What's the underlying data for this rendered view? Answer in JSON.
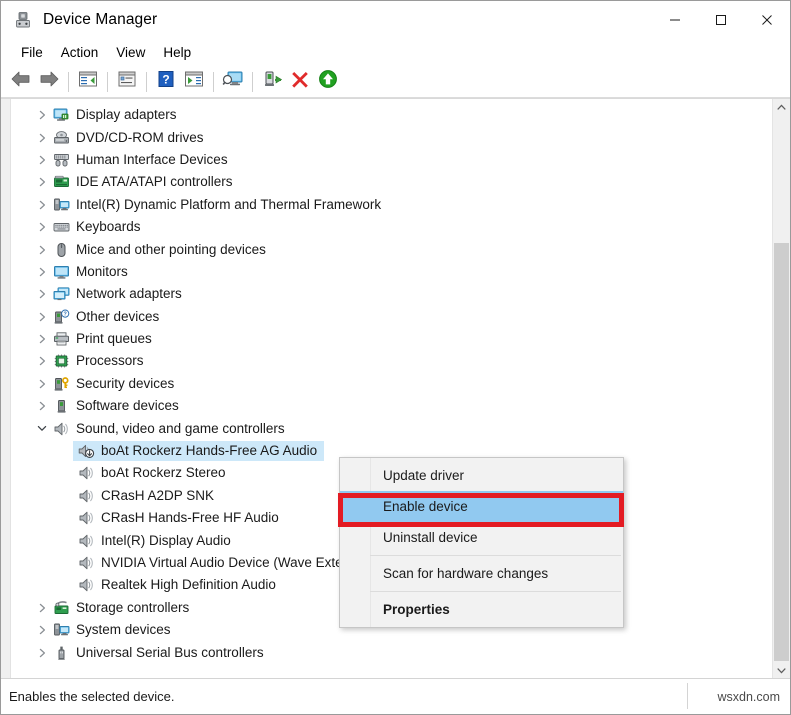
{
  "window": {
    "title": "Device Manager",
    "icon": "device-manager-icon",
    "controls": {
      "minimize": "Minimize",
      "maximize": "Maximize",
      "close": "Close"
    }
  },
  "menubar": {
    "items": [
      {
        "label": "File",
        "name": "menu-file"
      },
      {
        "label": "Action",
        "name": "menu-action"
      },
      {
        "label": "View",
        "name": "menu-view"
      },
      {
        "label": "Help",
        "name": "menu-help"
      }
    ]
  },
  "toolbar": {
    "buttons": [
      {
        "name": "back-button",
        "icon": "back-arrow-icon"
      },
      {
        "name": "forward-button",
        "icon": "forward-arrow-icon"
      },
      {
        "name": "show-hide-console-tree-button",
        "icon": "console-tree-icon"
      },
      {
        "name": "properties-button",
        "icon": "properties-window-icon"
      },
      {
        "name": "help-button",
        "icon": "help-question-icon"
      },
      {
        "name": "show-hide-action-pane-button",
        "icon": "action-pane-icon"
      },
      {
        "name": "scan-for-hardware-changes-button",
        "icon": "monitor-scan-icon"
      },
      {
        "name": "update-driver-button",
        "icon": "device-update-icon"
      },
      {
        "name": "disable-device-button",
        "icon": "red-x-icon"
      },
      {
        "name": "enable-device-button",
        "icon": "green-up-arrow-icon"
      }
    ]
  },
  "tree": {
    "items": [
      {
        "label": "Display adapters",
        "icon": "display-adapter-icon",
        "level": 1,
        "expander": "collapsed",
        "selected": false
      },
      {
        "label": "DVD/CD-ROM drives",
        "icon": "dvd-drive-icon",
        "level": 1,
        "expander": "collapsed",
        "selected": false
      },
      {
        "label": "Human Interface Devices",
        "icon": "hid-icon",
        "level": 1,
        "expander": "collapsed",
        "selected": false
      },
      {
        "label": "IDE ATA/ATAPI controllers",
        "icon": "ide-controller-icon",
        "level": 1,
        "expander": "collapsed",
        "selected": false
      },
      {
        "label": "Intel(R) Dynamic Platform and Thermal Framework",
        "icon": "system-device-icon",
        "level": 1,
        "expander": "collapsed",
        "selected": false
      },
      {
        "label": "Keyboards",
        "icon": "keyboard-icon",
        "level": 1,
        "expander": "collapsed",
        "selected": false
      },
      {
        "label": "Mice and other pointing devices",
        "icon": "mouse-icon",
        "level": 1,
        "expander": "collapsed",
        "selected": false
      },
      {
        "label": "Monitors",
        "icon": "monitor-icon",
        "level": 1,
        "expander": "collapsed",
        "selected": false
      },
      {
        "label": "Network adapters",
        "icon": "network-adapter-icon",
        "level": 1,
        "expander": "collapsed",
        "selected": false
      },
      {
        "label": "Other devices",
        "icon": "unknown-device-icon",
        "level": 1,
        "expander": "collapsed",
        "selected": false
      },
      {
        "label": "Print queues",
        "icon": "printer-icon",
        "level": 1,
        "expander": "collapsed",
        "selected": false
      },
      {
        "label": "Processors",
        "icon": "processor-icon",
        "level": 1,
        "expander": "collapsed",
        "selected": false
      },
      {
        "label": "Security devices",
        "icon": "security-device-icon",
        "level": 1,
        "expander": "collapsed",
        "selected": false
      },
      {
        "label": "Software devices",
        "icon": "software-device-icon",
        "level": 1,
        "expander": "collapsed",
        "selected": false
      },
      {
        "label": "Sound, video and game controllers",
        "icon": "speaker-icon",
        "level": 1,
        "expander": "expanded",
        "selected": false
      },
      {
        "label": "boAt Rockerz Hands-Free AG Audio",
        "icon": "disabled-speaker-icon",
        "level": 2,
        "expander": "none",
        "selected": true
      },
      {
        "label": "boAt Rockerz Stereo",
        "icon": "speaker-icon",
        "level": 2,
        "expander": "none",
        "selected": false
      },
      {
        "label": "CRasH A2DP SNK",
        "icon": "speaker-icon",
        "level": 2,
        "expander": "none",
        "selected": false
      },
      {
        "label": "CRasH Hands-Free HF Audio",
        "icon": "speaker-icon",
        "level": 2,
        "expander": "none",
        "selected": false
      },
      {
        "label": "Intel(R) Display Audio",
        "icon": "speaker-icon",
        "level": 2,
        "expander": "none",
        "selected": false
      },
      {
        "label": "NVIDIA Virtual Audio Device (Wave Extensible) (WDM)",
        "icon": "speaker-icon",
        "level": 2,
        "expander": "none",
        "selected": false
      },
      {
        "label": "Realtek High Definition Audio",
        "icon": "speaker-icon",
        "level": 2,
        "expander": "none",
        "selected": false
      },
      {
        "label": "Storage controllers",
        "icon": "storage-controller-icon",
        "level": 1,
        "expander": "collapsed",
        "selected": false
      },
      {
        "label": "System devices",
        "icon": "system-device-icon",
        "level": 1,
        "expander": "collapsed",
        "selected": false
      },
      {
        "label": "Universal Serial Bus controllers",
        "icon": "usb-icon",
        "level": 1,
        "expander": "collapsed",
        "selected": false
      }
    ]
  },
  "context_menu": {
    "items": [
      {
        "label": "Update driver",
        "name": "ctx-update-driver",
        "bold": false,
        "highlighted": false,
        "separator_before": false
      },
      {
        "label": "Enable device",
        "name": "ctx-enable-device",
        "bold": false,
        "highlighted": true,
        "separator_before": false
      },
      {
        "label": "Uninstall device",
        "name": "ctx-uninstall-device",
        "bold": false,
        "highlighted": false,
        "separator_before": false
      },
      {
        "label": "Scan for hardware changes",
        "name": "ctx-scan-for-hardware-changes",
        "bold": false,
        "highlighted": false,
        "separator_before": true
      },
      {
        "label": "Properties",
        "name": "ctx-properties",
        "bold": true,
        "highlighted": false,
        "separator_before": true
      }
    ],
    "highlight_color": "#91c9f0",
    "annotation_box_color": "#e31b23"
  },
  "statusbar": {
    "text": "Enables the selected device.",
    "watermark": "wsxdn.com"
  },
  "scrollbar": {
    "up_arrow": "˄",
    "down_arrow": "˅"
  }
}
